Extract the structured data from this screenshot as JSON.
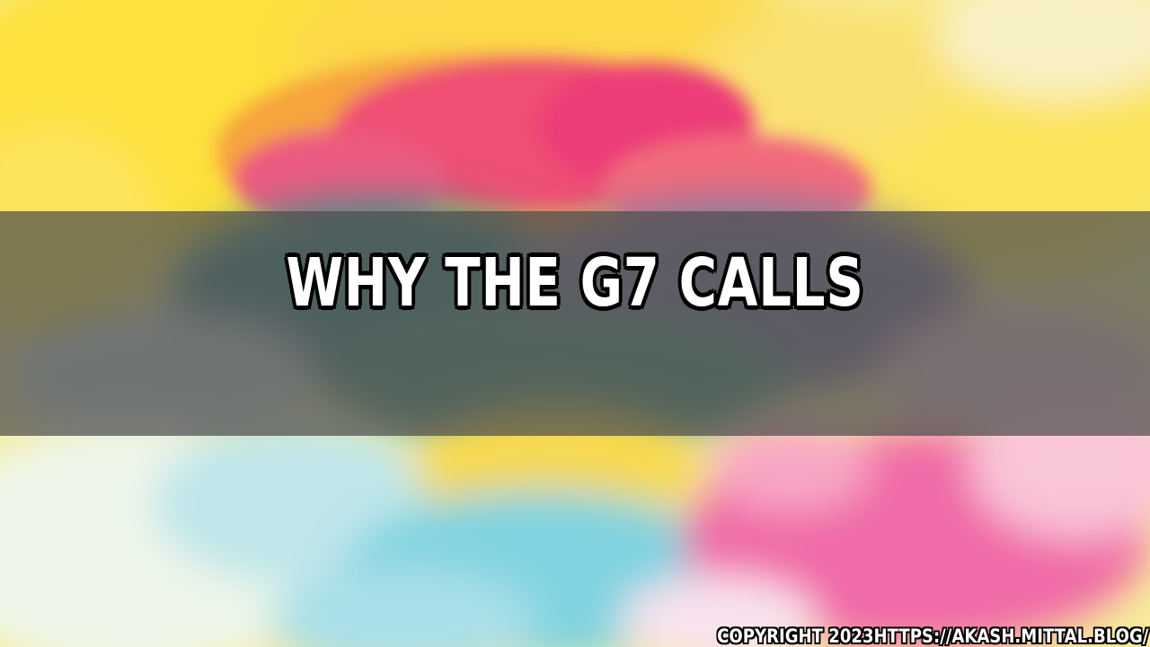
{
  "title": "WHY THE G7 CALLS",
  "copyright": "COPYRIGHT 2023HTTPS://AKASH.MITTAL.BLOG/",
  "colors": {
    "yellow": "#fde34a",
    "pink": "#ef4f86",
    "magenta": "#f06aa7",
    "cyan": "#7fd3e0",
    "banner": "#4e4e4e"
  }
}
